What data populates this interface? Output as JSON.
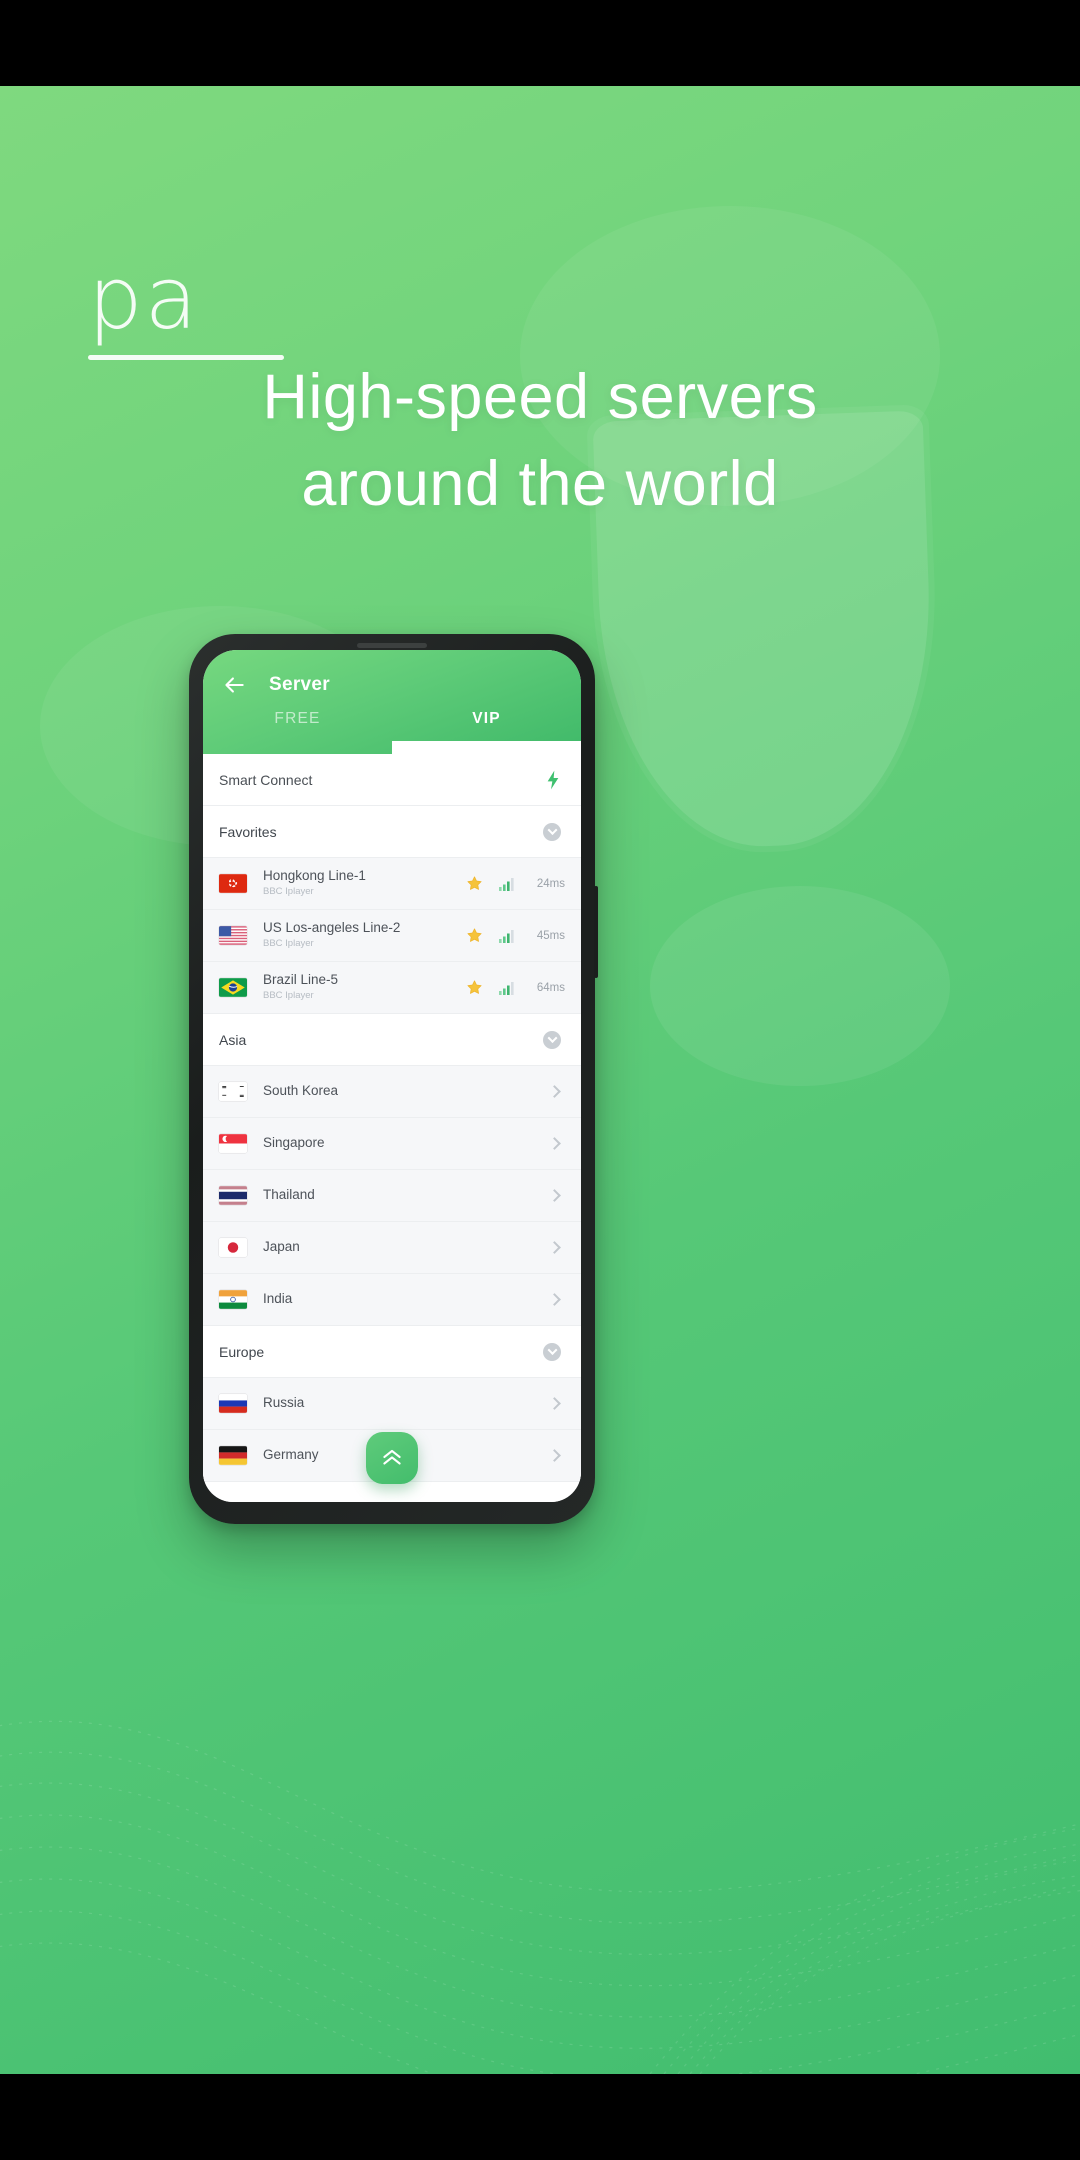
{
  "promo": {
    "logo_text": "pa",
    "headline_line1": "High-speed servers",
    "headline_line2": "around the world"
  },
  "app": {
    "header": {
      "back_icon": "arrow-left-icon",
      "title": "Server"
    },
    "tabs": [
      {
        "label": "FREE",
        "active": false
      },
      {
        "label": "VIP",
        "active": true
      }
    ],
    "smart_connect": {
      "label": "Smart Connect",
      "icon": "lightning-bolt-icon"
    },
    "sections": [
      {
        "name": "Favorites",
        "collapse_icon": "chevron-down-circle-icon",
        "servers": [
          {
            "flag": "hongkong-flag",
            "name": "Hongkong Line-1",
            "subtitle": "BBC Iplayer",
            "starred": true,
            "signal": "signal-bars-icon",
            "latency": "24ms"
          },
          {
            "flag": "us-flag",
            "name": "US Los-angeles Line-2",
            "subtitle": "BBC Iplayer",
            "starred": true,
            "signal": "signal-bars-icon",
            "latency": "45ms"
          },
          {
            "flag": "brazil-flag",
            "name": "Brazil Line-5",
            "subtitle": "BBC Iplayer",
            "starred": true,
            "signal": "signal-bars-icon",
            "latency": "64ms"
          }
        ]
      },
      {
        "name": "Asia",
        "collapse_icon": "chevron-down-circle-icon",
        "countries": [
          {
            "flag": "south-korea-flag",
            "name": "South Korea"
          },
          {
            "flag": "singapore-flag",
            "name": "Singapore"
          },
          {
            "flag": "thailand-flag",
            "name": "Thailand"
          },
          {
            "flag": "japan-flag",
            "name": "Japan"
          },
          {
            "flag": "india-flag",
            "name": "India"
          }
        ]
      },
      {
        "name": "Europe",
        "collapse_icon": "chevron-down-circle-icon",
        "countries": [
          {
            "flag": "russia-flag",
            "name": "Russia"
          },
          {
            "flag": "germany-flag",
            "name": "Germany"
          }
        ]
      }
    ],
    "scroll_top_button": {
      "icon": "double-chevron-up-icon"
    }
  },
  "colors": {
    "brand_green": "#44bd6d",
    "header_green_light": "#76d87f",
    "star_yellow": "#f5c33b",
    "signal_green": "#3fb56f",
    "sheet_white": "#ffffff",
    "row_alt": "#f6f7f9",
    "text_primary": "#4d5259",
    "text_muted": "#b6bcc3"
  }
}
